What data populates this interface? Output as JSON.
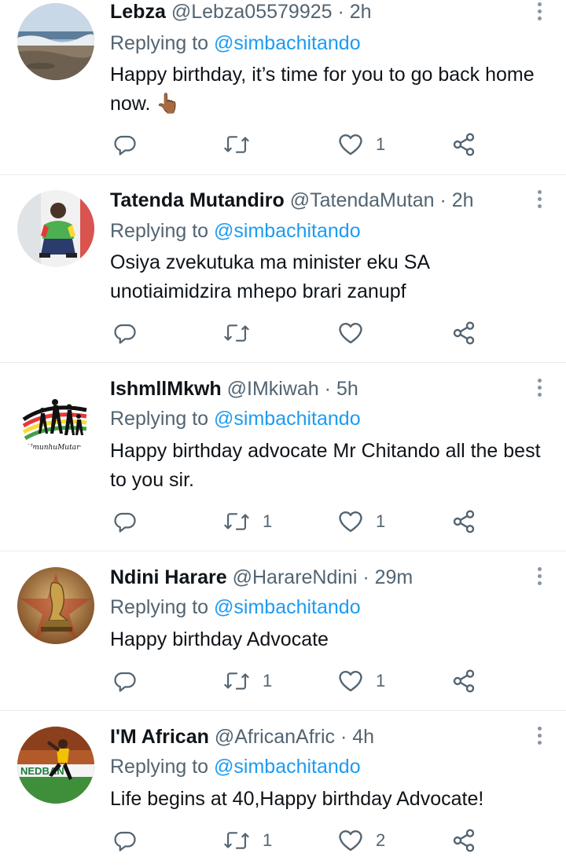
{
  "tweets": [
    {
      "name": "Lebza",
      "handle": "@Lebza05579925",
      "time": "2h",
      "replying_prefix": "Replying to",
      "replying_to": "@simbachitando",
      "text": "Happy birthday, it’s time for you to go back home now. 👆🏾",
      "replies": "",
      "retweets": "",
      "likes": "1"
    },
    {
      "name": "Tatenda Mutandiro",
      "handle": "@TatendaMutan",
      "time": "2h",
      "replying_prefix": "Replying to",
      "replying_to": "@simbachitando",
      "text": "Osiya zvekutuka ma minister eku SA unotiaimidzira mhepo brari zanupf",
      "replies": "",
      "retweets": "",
      "likes": ""
    },
    {
      "name": "IshmllMkwh",
      "handle": "@IMkiwah",
      "time": "5h",
      "replying_prefix": "Replying to",
      "replying_to": "@simbachitando",
      "text": "Happy birthday advocate Mr Chitando all the best to you sir.",
      "avatar_caption": "UmunhuMutapa",
      "replies": "",
      "retweets": "1",
      "likes": "1"
    },
    {
      "name": "Ndini Harare",
      "handle": "@HarareNdini",
      "time": "29m",
      "replying_prefix": "Replying to",
      "replying_to": "@simbachitando",
      "text": "Happy birthday Advocate",
      "replies": "",
      "retweets": "1",
      "likes": "1"
    },
    {
      "name": "I'M African",
      "handle": "@AfricanAfric",
      "time": "4h",
      "replying_prefix": "Replying to",
      "replying_to": "@simbachitando",
      "text": "Life begins at 40,Happy birthday Advocate!",
      "avatar_caption": "NEDBAN",
      "replies": "",
      "retweets": "1",
      "likes": "2"
    }
  ],
  "icons": {
    "reply": "reply-icon",
    "retweet": "retweet-icon",
    "like": "heart-icon",
    "share": "share-icon",
    "more": "more-options-icon"
  },
  "colors": {
    "link": "#1d9bf0",
    "secondary_text": "#536471",
    "primary_text": "#0f1419",
    "divider": "#e6ecf0"
  }
}
